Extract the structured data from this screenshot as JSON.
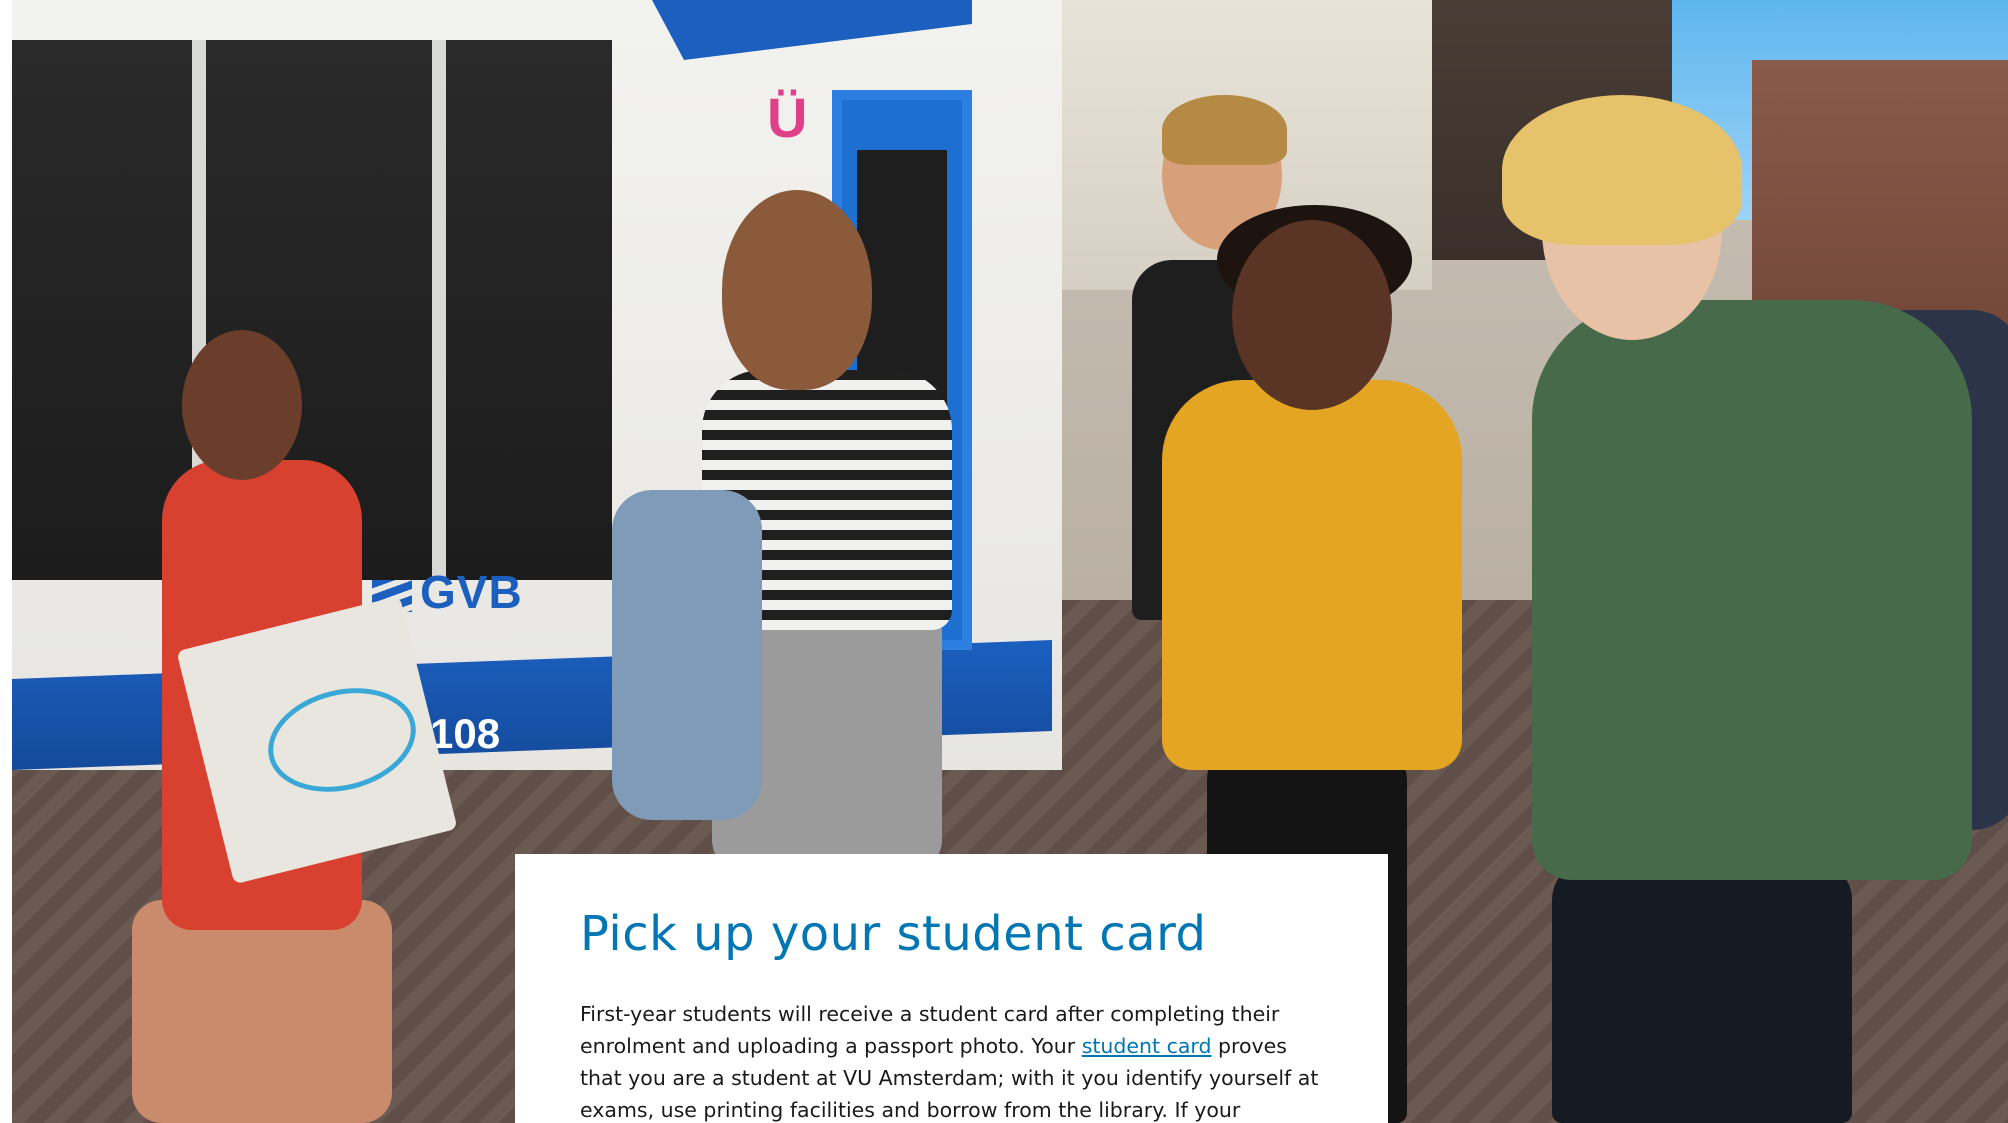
{
  "hero": {
    "tram_logo": "GVB",
    "tram_number": "108",
    "shop_sign": "Ü"
  },
  "card": {
    "title": "Pick up your student card",
    "text_part1": "First-year students will receive a student card after completing their enrolment and uploading a passport photo. Your ",
    "link_text": "student card",
    "text_part2": " proves that you are a student at VU Amsterdam; with it you identify yourself at exams, use printing facilities and borrow from the library. If your"
  },
  "colors": {
    "accent": "#0077b3",
    "text": "#1a1a1a",
    "card_background": "#ffffff"
  }
}
